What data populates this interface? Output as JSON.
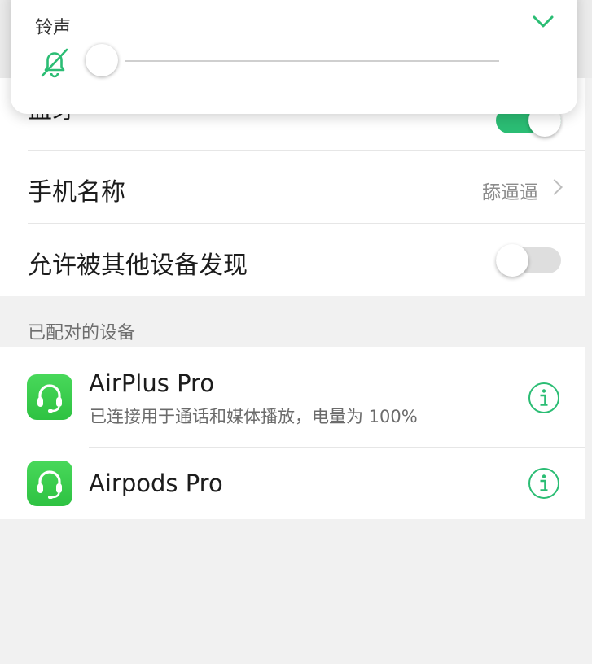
{
  "volume_panel": {
    "title": "铃声",
    "bell_icon": "bell-off-icon",
    "collapse_icon": "chevron-down-icon",
    "level": 0,
    "accent": "#2bbd74"
  },
  "bluetooth": {
    "label": "蓝牙",
    "enabled": true,
    "accent": "#2bbd74"
  },
  "device_name": {
    "label": "手机名称",
    "value": "舔逼逼",
    "chevron_icon": "chevron-right-icon"
  },
  "discoverable": {
    "label": "允许被其他设备发现",
    "enabled": false
  },
  "paired_section": {
    "header": "已配对的设备",
    "devices": [
      {
        "name": "AirPlus Pro",
        "status": "已连接用于通话和媒体播放，电量为 100%",
        "icon": "headset-icon",
        "info_icon": "info-icon"
      },
      {
        "name": "Airpods Pro",
        "icon": "headset-icon",
        "info_icon": "info-icon"
      }
    ]
  }
}
